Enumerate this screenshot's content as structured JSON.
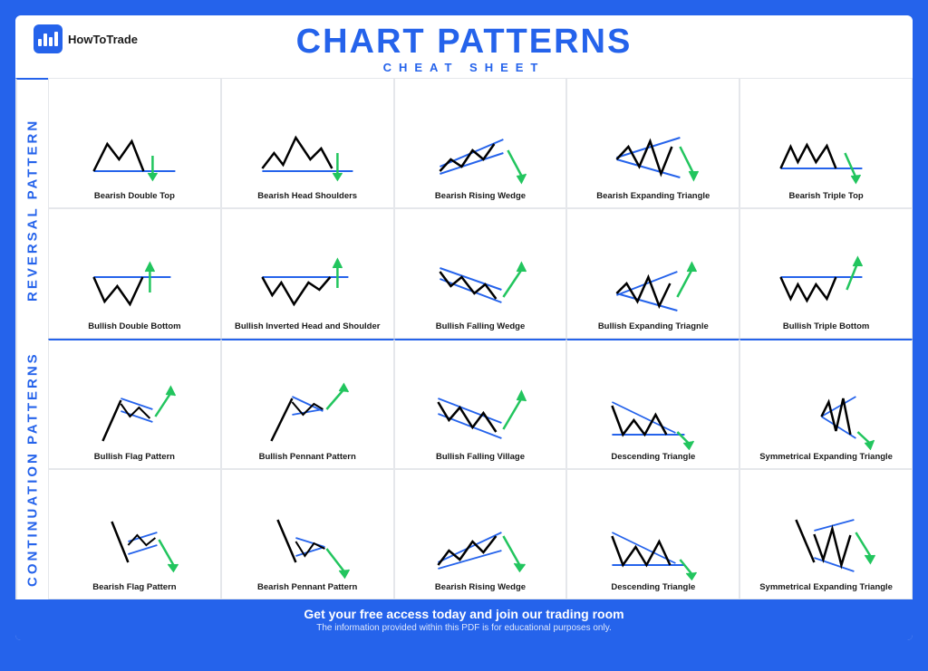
{
  "logo": {
    "text": "HowToTrade"
  },
  "header": {
    "main_title": "CHART PATTERNS",
    "sub_title": "CHEAT SHEET"
  },
  "sections": {
    "reversal": "REVERSAL PATTERN",
    "continuation": "CONTINUATION PATTERNS"
  },
  "patterns": [
    {
      "id": "bearish-double-top",
      "label": "Bearish Double Top",
      "type": "bearish-top"
    },
    {
      "id": "bearish-head-shoulders",
      "label": "Bearish Head Shoulders",
      "type": "bearish-hs"
    },
    {
      "id": "bearish-rising-wedge",
      "label": "Bearish Rising Wedge",
      "type": "bearish-rw"
    },
    {
      "id": "bearish-expanding-triangle",
      "label": "Bearish Expanding Triangle",
      "type": "bearish-et"
    },
    {
      "id": "bearish-triple-top",
      "label": "Bearish Triple Top",
      "type": "bearish-tt"
    },
    {
      "id": "bullish-double-bottom",
      "label": "Bullish Double Bottom",
      "type": "bullish-bottom"
    },
    {
      "id": "bullish-inverted-hs",
      "label": "Bullish Inverted Head and Shoulder",
      "type": "bullish-ihs"
    },
    {
      "id": "bullish-falling-wedge",
      "label": "Bullish Falling Wedge",
      "type": "bullish-fw"
    },
    {
      "id": "bullish-expanding-triangle",
      "label": "Bullish Expanding Triagnle",
      "type": "bullish-et"
    },
    {
      "id": "bullish-triple-bottom",
      "label": "Bullish Triple Bottom",
      "type": "bullish-tb"
    },
    {
      "id": "bullish-flag",
      "label": "Bullish Flag Pattern",
      "type": "bullish-flag"
    },
    {
      "id": "bullish-pennant",
      "label": "Bullish Pennant Pattern",
      "type": "bullish-pennant"
    },
    {
      "id": "bullish-falling-village",
      "label": "Bullish Falling Village",
      "type": "bullish-fv"
    },
    {
      "id": "descending-triangle-1",
      "label": "Descending Triangle",
      "type": "desc-tri"
    },
    {
      "id": "sym-expanding-1",
      "label": "Symmetrical Expanding Triangle",
      "type": "sym-exp"
    },
    {
      "id": "bearish-flag",
      "label": "Bearish Flag Pattern",
      "type": "bearish-flag"
    },
    {
      "id": "bearish-pennant",
      "label": "Bearish Pennant Pattern",
      "type": "bearish-pennant"
    },
    {
      "id": "bearish-rising-wedge-2",
      "label": "Bearish Rising Wedge",
      "type": "bearish-rw2"
    },
    {
      "id": "descending-triangle-2",
      "label": "Descending Triangle",
      "type": "desc-tri2"
    },
    {
      "id": "sym-expanding-2",
      "label": "Symmetrical Expanding Triangle",
      "type": "sym-exp2"
    }
  ],
  "footer": {
    "main": "Get your free access today and join our trading room",
    "sub": "The information provided within this PDF is for educational purposes only."
  }
}
